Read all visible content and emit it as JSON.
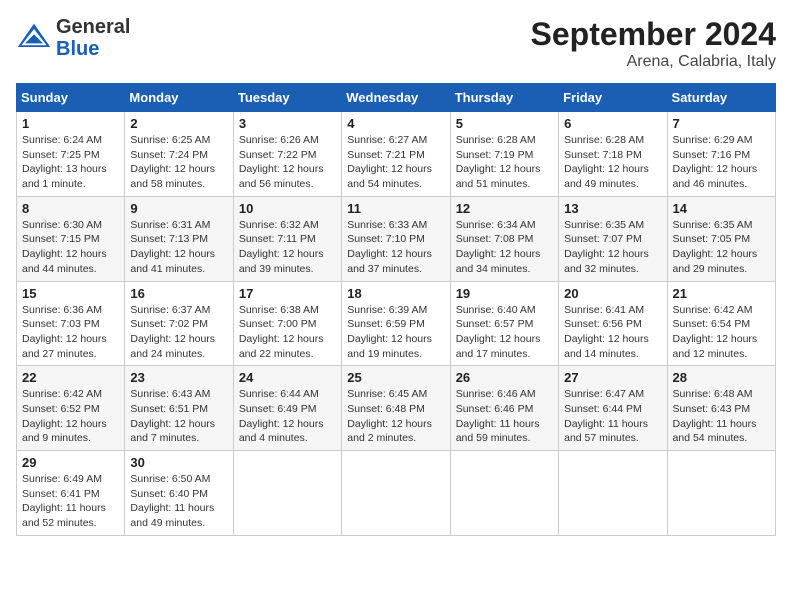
{
  "header": {
    "logo_general": "General",
    "logo_blue": "Blue",
    "title": "September 2024",
    "subtitle": "Arena, Calabria, Italy"
  },
  "weekdays": [
    "Sunday",
    "Monday",
    "Tuesday",
    "Wednesday",
    "Thursday",
    "Friday",
    "Saturday"
  ],
  "weeks": [
    [
      {
        "day": "1",
        "info": "Sunrise: 6:24 AM\nSunset: 7:25 PM\nDaylight: 13 hours\nand 1 minute."
      },
      {
        "day": "2",
        "info": "Sunrise: 6:25 AM\nSunset: 7:24 PM\nDaylight: 12 hours\nand 58 minutes."
      },
      {
        "day": "3",
        "info": "Sunrise: 6:26 AM\nSunset: 7:22 PM\nDaylight: 12 hours\nand 56 minutes."
      },
      {
        "day": "4",
        "info": "Sunrise: 6:27 AM\nSunset: 7:21 PM\nDaylight: 12 hours\nand 54 minutes."
      },
      {
        "day": "5",
        "info": "Sunrise: 6:28 AM\nSunset: 7:19 PM\nDaylight: 12 hours\nand 51 minutes."
      },
      {
        "day": "6",
        "info": "Sunrise: 6:28 AM\nSunset: 7:18 PM\nDaylight: 12 hours\nand 49 minutes."
      },
      {
        "day": "7",
        "info": "Sunrise: 6:29 AM\nSunset: 7:16 PM\nDaylight: 12 hours\nand 46 minutes."
      }
    ],
    [
      {
        "day": "8",
        "info": "Sunrise: 6:30 AM\nSunset: 7:15 PM\nDaylight: 12 hours\nand 44 minutes."
      },
      {
        "day": "9",
        "info": "Sunrise: 6:31 AM\nSunset: 7:13 PM\nDaylight: 12 hours\nand 41 minutes."
      },
      {
        "day": "10",
        "info": "Sunrise: 6:32 AM\nSunset: 7:11 PM\nDaylight: 12 hours\nand 39 minutes."
      },
      {
        "day": "11",
        "info": "Sunrise: 6:33 AM\nSunset: 7:10 PM\nDaylight: 12 hours\nand 37 minutes."
      },
      {
        "day": "12",
        "info": "Sunrise: 6:34 AM\nSunset: 7:08 PM\nDaylight: 12 hours\nand 34 minutes."
      },
      {
        "day": "13",
        "info": "Sunrise: 6:35 AM\nSunset: 7:07 PM\nDaylight: 12 hours\nand 32 minutes."
      },
      {
        "day": "14",
        "info": "Sunrise: 6:35 AM\nSunset: 7:05 PM\nDaylight: 12 hours\nand 29 minutes."
      }
    ],
    [
      {
        "day": "15",
        "info": "Sunrise: 6:36 AM\nSunset: 7:03 PM\nDaylight: 12 hours\nand 27 minutes."
      },
      {
        "day": "16",
        "info": "Sunrise: 6:37 AM\nSunset: 7:02 PM\nDaylight: 12 hours\nand 24 minutes."
      },
      {
        "day": "17",
        "info": "Sunrise: 6:38 AM\nSunset: 7:00 PM\nDaylight: 12 hours\nand 22 minutes."
      },
      {
        "day": "18",
        "info": "Sunrise: 6:39 AM\nSunset: 6:59 PM\nDaylight: 12 hours\nand 19 minutes."
      },
      {
        "day": "19",
        "info": "Sunrise: 6:40 AM\nSunset: 6:57 PM\nDaylight: 12 hours\nand 17 minutes."
      },
      {
        "day": "20",
        "info": "Sunrise: 6:41 AM\nSunset: 6:56 PM\nDaylight: 12 hours\nand 14 minutes."
      },
      {
        "day": "21",
        "info": "Sunrise: 6:42 AM\nSunset: 6:54 PM\nDaylight: 12 hours\nand 12 minutes."
      }
    ],
    [
      {
        "day": "22",
        "info": "Sunrise: 6:42 AM\nSunset: 6:52 PM\nDaylight: 12 hours\nand 9 minutes."
      },
      {
        "day": "23",
        "info": "Sunrise: 6:43 AM\nSunset: 6:51 PM\nDaylight: 12 hours\nand 7 minutes."
      },
      {
        "day": "24",
        "info": "Sunrise: 6:44 AM\nSunset: 6:49 PM\nDaylight: 12 hours\nand 4 minutes."
      },
      {
        "day": "25",
        "info": "Sunrise: 6:45 AM\nSunset: 6:48 PM\nDaylight: 12 hours\nand 2 minutes."
      },
      {
        "day": "26",
        "info": "Sunrise: 6:46 AM\nSunset: 6:46 PM\nDaylight: 11 hours\nand 59 minutes."
      },
      {
        "day": "27",
        "info": "Sunrise: 6:47 AM\nSunset: 6:44 PM\nDaylight: 11 hours\nand 57 minutes."
      },
      {
        "day": "28",
        "info": "Sunrise: 6:48 AM\nSunset: 6:43 PM\nDaylight: 11 hours\nand 54 minutes."
      }
    ],
    [
      {
        "day": "29",
        "info": "Sunrise: 6:49 AM\nSunset: 6:41 PM\nDaylight: 11 hours\nand 52 minutes."
      },
      {
        "day": "30",
        "info": "Sunrise: 6:50 AM\nSunset: 6:40 PM\nDaylight: 11 hours\nand 49 minutes."
      },
      {
        "day": "",
        "info": ""
      },
      {
        "day": "",
        "info": ""
      },
      {
        "day": "",
        "info": ""
      },
      {
        "day": "",
        "info": ""
      },
      {
        "day": "",
        "info": ""
      }
    ]
  ]
}
